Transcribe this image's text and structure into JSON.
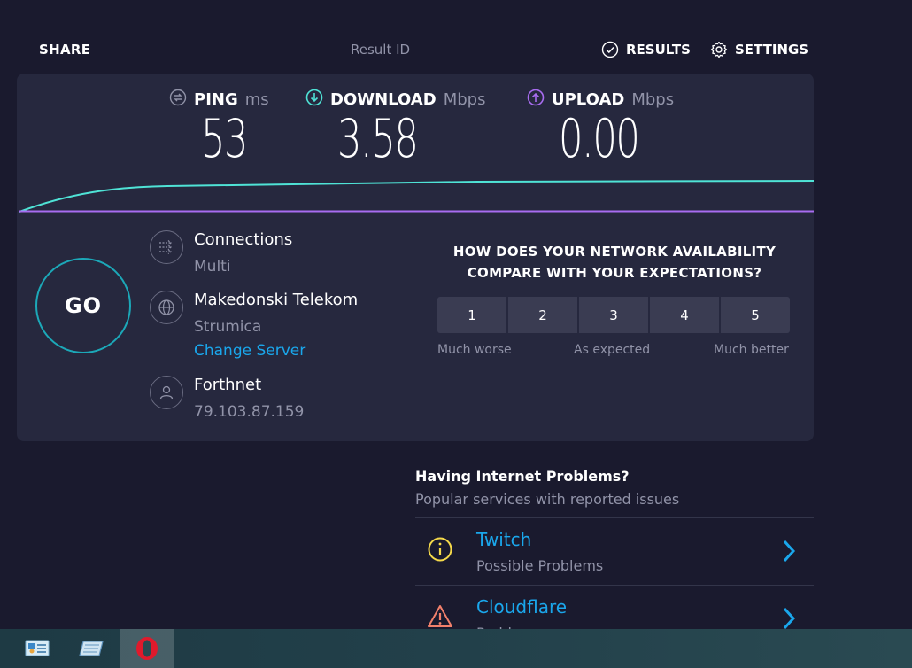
{
  "header": {
    "share_label": "SHARE",
    "result_id_label": "Result ID",
    "results_label": "RESULTS",
    "settings_label": "SETTINGS"
  },
  "metrics": {
    "ping": {
      "name": "PING",
      "unit": "ms",
      "value": "53"
    },
    "download": {
      "name": "DOWNLOAD",
      "unit": "Mbps",
      "value": "3.58"
    },
    "upload": {
      "name": "UPLOAD",
      "unit": "Mbps",
      "value": "0.00"
    }
  },
  "go_label": "GO",
  "connection": {
    "connections_label": "Connections",
    "connections_value": "Multi",
    "server_name": "Makedonski Telekom",
    "server_location": "Strumica",
    "change_server_label": "Change Server",
    "isp_name": "Forthnet",
    "ip_address": "79.103.87.159"
  },
  "survey": {
    "question_line1": "HOW DOES YOUR NETWORK AVAILABILITY",
    "question_line2": "COMPARE WITH YOUR EXPECTATIONS?",
    "options": [
      "1",
      "2",
      "3",
      "4",
      "5"
    ],
    "scale_low": "Much worse",
    "scale_mid": "As expected",
    "scale_high": "Much better"
  },
  "problems": {
    "title": "Having Internet Problems?",
    "subtitle": "Popular services with reported issues",
    "items": [
      {
        "name": "Twitch",
        "status": "Possible Problems",
        "icon": "info-icon"
      },
      {
        "name": "Cloudflare",
        "status": "Problems",
        "icon": "warning-icon"
      }
    ]
  },
  "colors": {
    "background": "#1a1a2e",
    "card": "#26283e",
    "download_accent": "#4fe3d6",
    "upload_accent": "#a86cf0",
    "link": "#1aa7ec",
    "go_ring": "#1ca8b8"
  },
  "taskbar": {
    "items": [
      "control-panel-icon",
      "file-manager-icon",
      "opera-browser-icon"
    ]
  }
}
